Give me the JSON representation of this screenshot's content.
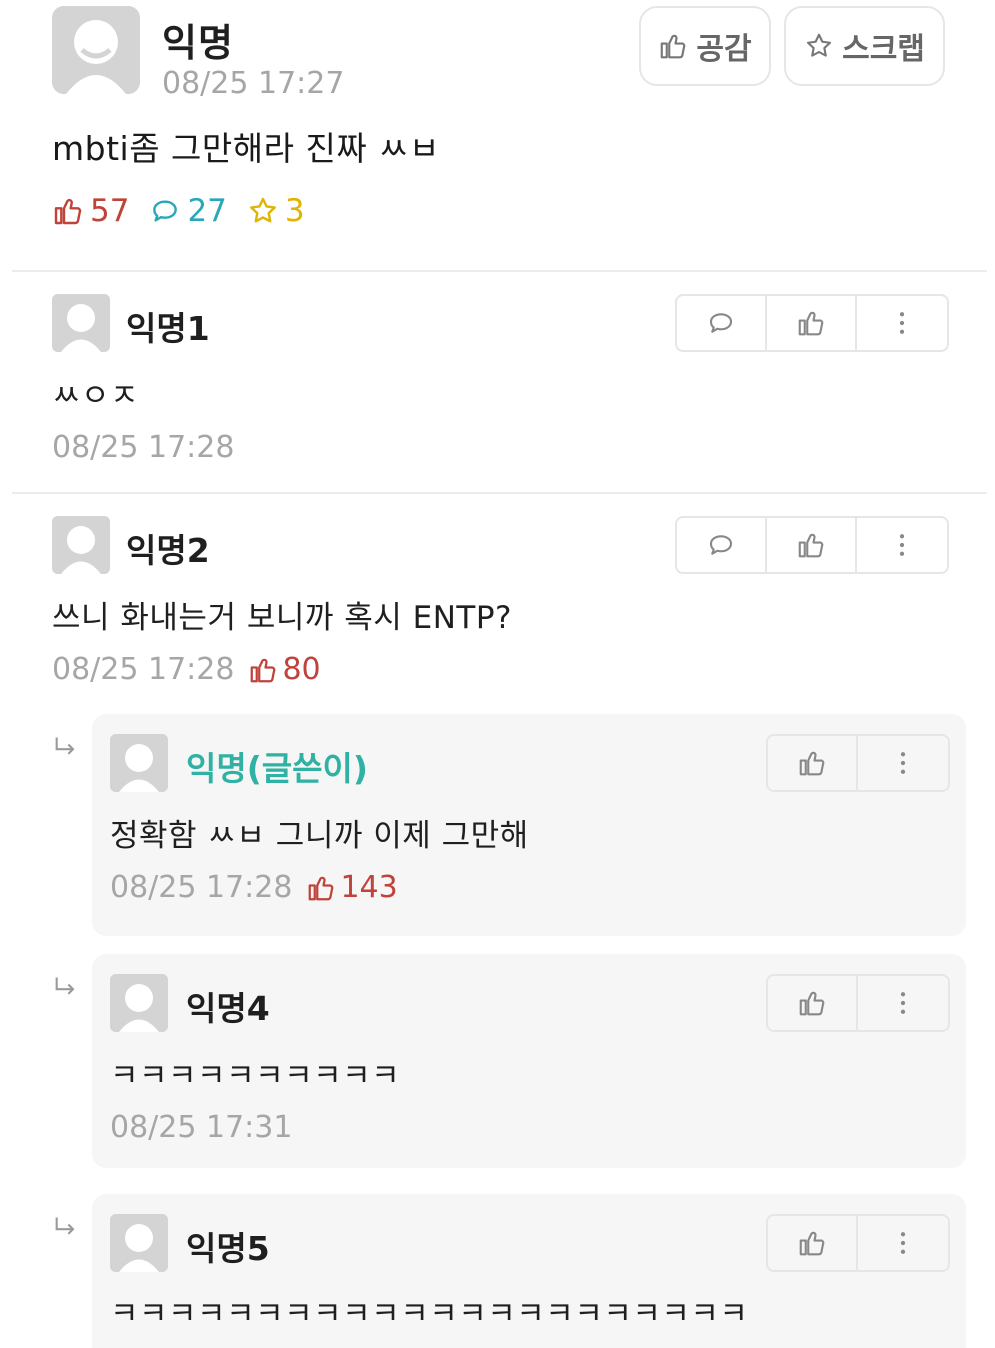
{
  "post": {
    "author": "익명",
    "time": "08/25 17:27",
    "body": "mbti좀 그만해라 진짜 ㅆㅂ",
    "like_button": "공감",
    "scrap_button": "스크랩",
    "stats": {
      "votes": "57",
      "comments": "27",
      "scraps": "3"
    },
    "colors": {
      "vote": "#c0433b",
      "comment": "#2aa7b8",
      "scrap": "#e0b400"
    }
  },
  "comments": [
    {
      "author": "익명1",
      "body": "ㅆㅇㅈ",
      "time": "08/25 17:28",
      "votes": ""
    },
    {
      "author": "익명2",
      "body": "쓰니 화내는거 보니까 혹시 ENTP?",
      "time": "08/25 17:28",
      "votes": "80"
    }
  ],
  "replies": [
    {
      "author": "익명(글쓴이)",
      "body": "정확함 ㅆㅂ 그니까 이제 그만해",
      "time": "08/25 17:28",
      "votes": "143"
    },
    {
      "author": "익명4",
      "body": "ㅋㅋㅋㅋㅋㅋㅋㅋㅋㅋ",
      "time": "08/25 17:31",
      "votes": ""
    },
    {
      "author": "익명5",
      "body": "ㅋㅋㅋㅋㅋㅋㅋㅋㅋㅋㅋㅋㅋㅋㅋㅋㅋㅋㅋㅋㅋㅋ",
      "time": "",
      "votes": ""
    }
  ],
  "icons": {
    "avatar": "default-avatar-icon",
    "like": "thumbs-up-icon",
    "scrap": "star-icon",
    "comment": "speech-bubble-icon",
    "more": "more-vertical-icon",
    "reply": "reply-arrow-icon"
  }
}
